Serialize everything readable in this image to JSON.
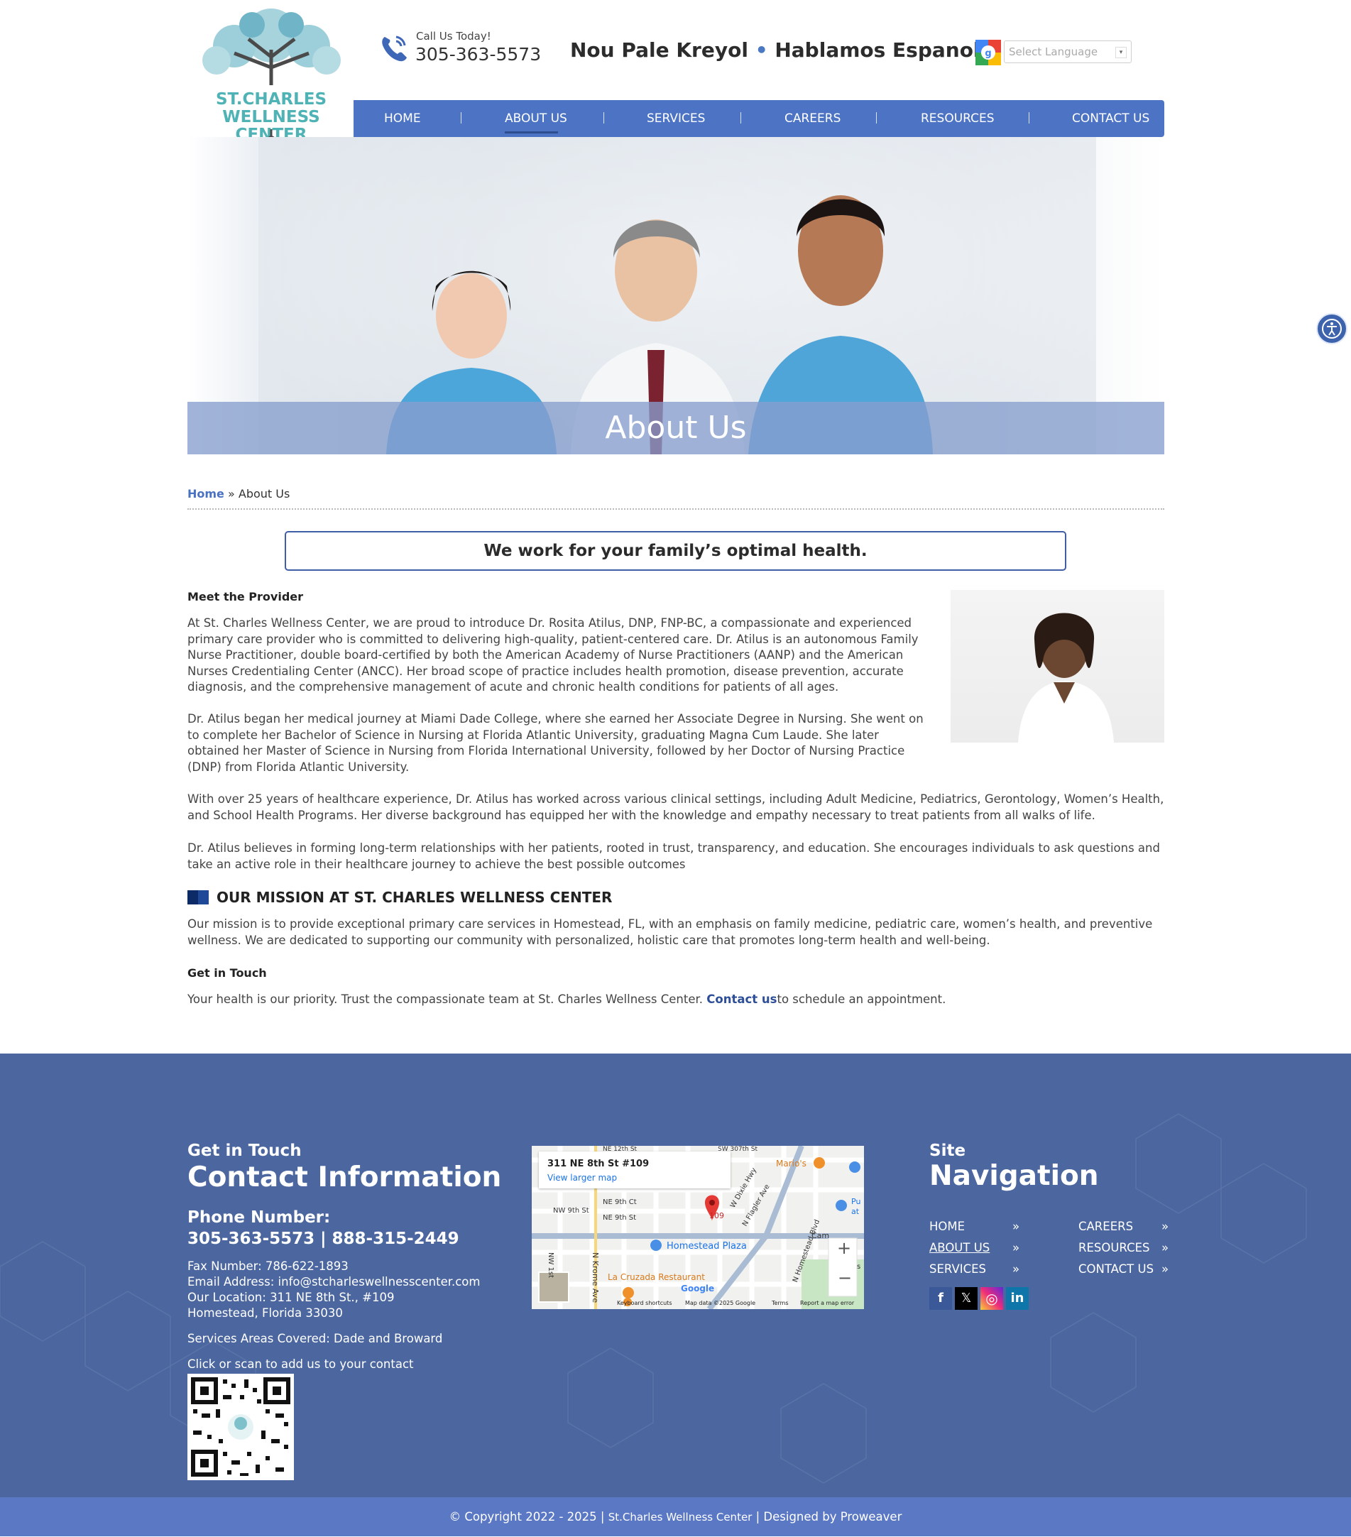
{
  "brand": {
    "name_line1": "ST.CHARLES",
    "name_line2": "WELLNESS CENTER",
    "accent": "#4fb2b5",
    "primary": "#4d74c4"
  },
  "header": {
    "call_label": "Call Us Today!",
    "call_number": "305-363-5573",
    "lang_part1": "Nou Pale Kreyol",
    "lang_dot": "•",
    "lang_part2": "Hablamos Espanol",
    "language_select_placeholder": "Select Language"
  },
  "nav": {
    "items": [
      {
        "label": "HOME"
      },
      {
        "label": "ABOUT US"
      },
      {
        "label": "SERVICES"
      },
      {
        "label": "CAREERS"
      },
      {
        "label": "RESOURCES"
      },
      {
        "label": "CONTACT US"
      }
    ],
    "active": "ABOUT US"
  },
  "hero": {
    "title": "About Us"
  },
  "breadcrumb": {
    "home": "Home",
    "separator": " » ",
    "current": "About Us"
  },
  "content": {
    "tagline": "We work for your family’s optimal health.",
    "meet_heading": "Meet the Provider",
    "p1": "At St. Charles Wellness Center, we are proud to introduce Dr. Rosita Atilus, DNP, FNP-BC, a compassionate and experienced primary care provider who is committed to delivering high-quality, patient-centered care. Dr. Atilus is an autonomous Family Nurse Practitioner, double board-certified by both the American Academy of Nurse Practitioners (AANP) and the American Nurses Credentialing Center (ANCC). Her broad scope of practice includes health promotion, disease prevention, accurate diagnosis, and the comprehensive management of acute and chronic health conditions for patients of all ages.",
    "p2": "Dr. Atilus began her medical journey at Miami Dade College, where she earned her Associate Degree in Nursing. She went on to complete her Bachelor of Science in Nursing at Florida Atlantic University, graduating Magna Cum Laude. She later obtained her Master of Science in Nursing from Florida International University, followed by her Doctor of Nursing Practice (DNP) from Florida Atlantic University.",
    "p3": "With over 25 years of healthcare experience, Dr. Atilus has worked across various clinical settings, including Adult Medicine, Pediatrics, Gerontology, Women’s Health, and School Health Programs. Her diverse background has equipped her with the knowledge and empathy necessary to treat patients from all walks of life.",
    "p4": "Dr. Atilus believes in forming long-term relationships with her patients, rooted in trust, transparency, and education. She encourages individuals to ask questions and take an active role in their healthcare journey to achieve the best possible outcomes",
    "mission_heading": "OUR MISSION AT ST. CHARLES WELLNESS CENTER",
    "mission_text": "Our mission is to provide exceptional primary care services in Homestead, FL, with an emphasis on family medicine, pediatric care, women’s health, and preventive wellness. We are dedicated to supporting our community with personalized, holistic care that promotes long-term health and well-being.",
    "touch_heading": "Get in Touch",
    "touch_text_before": "Your health is our priority. Trust the compassionate team at St. Charles Wellness Center. ",
    "touch_link": "Contact us",
    "touch_text_after": "to schedule an appointment."
  },
  "footer": {
    "contact_sub": "Get in Touch",
    "contact_title": "Contact Information",
    "phone_heading": "Phone Number:",
    "phone_numbers": "305-363-5573 | 888-315-2449",
    "fax": "Fax Number: 786-622-1893",
    "email": "Email Address: info@stcharleswellnesscenter.com",
    "location": "Our Location: 311 NE 8th St., #109",
    "city": "Homestead, Florida 33030",
    "areas": "Services Areas Covered: Dade and Broward",
    "scan": "Click or scan to add us to your contact",
    "map": {
      "address": "311 NE 8th St #109",
      "larger_map": "View larger map",
      "labels": [
        "NE 12th St",
        "SW 307th St",
        "Mario's",
        "NE 9th Ct",
        "NW 9th St",
        "NE 9th St",
        "109",
        "W Dixie Hwy",
        "N Flagler Ave",
        "Homestead Plaza",
        "N Homestead Blvd",
        "NW 1st",
        "N Krome Ave",
        "La Cruzada Restaurant",
        "Cam",
        "Pu",
        "at",
        "s",
        "Google"
      ],
      "footer_links": [
        "Keyboard shortcuts",
        "Map data ©2025 Google",
        "Terms",
        "Report a map error"
      ],
      "zoom_in": "+",
      "zoom_out": "−"
    },
    "nav_sub": "Site",
    "nav_title": "Navigation",
    "nav_items": [
      {
        "label": "HOME"
      },
      {
        "label": "ABOUT US"
      },
      {
        "label": "SERVICES"
      },
      {
        "label": "CAREERS"
      },
      {
        "label": "RESOURCES"
      },
      {
        "label": "CONTACT US"
      }
    ],
    "nav_arrow": "»",
    "social": [
      {
        "icon": "facebook-icon",
        "glyph": "f",
        "color": "#3b5998"
      },
      {
        "icon": "x-icon",
        "glyph": "𝕏",
        "color": "#000000"
      },
      {
        "icon": "instagram-icon",
        "glyph": "◎",
        "color": "#d6249f"
      },
      {
        "icon": "linkedin-icon",
        "glyph": "in",
        "color": "#0e76a8"
      }
    ]
  },
  "copyright": {
    "text": "© Copyright 2022 - 2025",
    "site": "St.Charles Wellness Center",
    "designed": "Designed by Proweaver"
  }
}
